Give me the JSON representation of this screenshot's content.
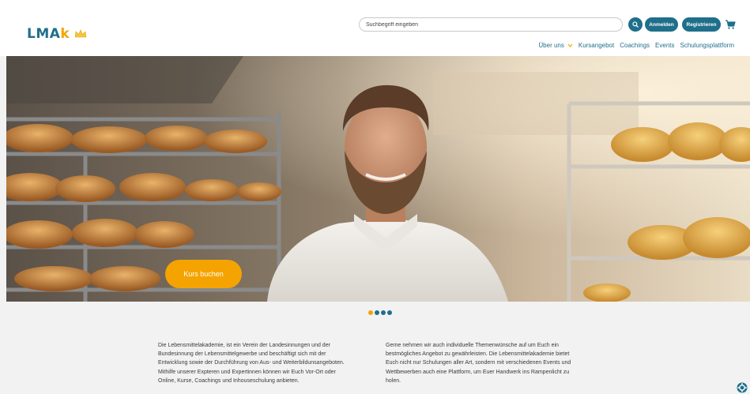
{
  "header": {
    "logo_main": "LMA",
    "logo_accent": "k",
    "search_placeholder": "Suchbegriff eingeben",
    "login_label": "Anmelden",
    "register_label": "Registrieren",
    "nav": [
      {
        "label": "Über uns",
        "has_dropdown": true
      },
      {
        "label": "Kursangebot"
      },
      {
        "label": "Coachings"
      },
      {
        "label": "Events"
      },
      {
        "label": "Schulungsplattform"
      }
    ],
    "icons": {
      "search": "search-icon",
      "cart": "cart-icon",
      "chevron": "chevron-down-icon",
      "crown": "crown-icon"
    }
  },
  "hero": {
    "cta_label": "Kurs buchen",
    "slides_total": 4,
    "active_slide": 1
  },
  "intro": {
    "left": "Die Lebensmittelakademie, ist ein Verein der Landesinnungen und der\nBundesinnung der Lebensmittelgewerbe und beschäftigt sich mit der\nEntwicklung sowie der Durchführung von Aus- und Weiterbildunsangeboten.\nMithilfe unserer Expteren und Expertinnen können wir Euch Vor-Ort oder\nOnline, Kurse, Coachings und Inhouseschulung anbieten.",
    "right": "Gerne nehmen wir auch individuelle Themenwünsche auf um Euch ein\nbestmögliches Angebot zu gewährleisten. Die Lebensmittelakademie bietet\nEuch nicht nur Schulungen aller Art, sondern mit verschiedenen Events und\nWettbewerben auch eine Plattform, um Euer Handwerk ins Rampenlicht zu\nholen."
  },
  "colors": {
    "brand": "#1f6f8b",
    "accent": "#f5a300",
    "background": "#f2f2f2"
  }
}
